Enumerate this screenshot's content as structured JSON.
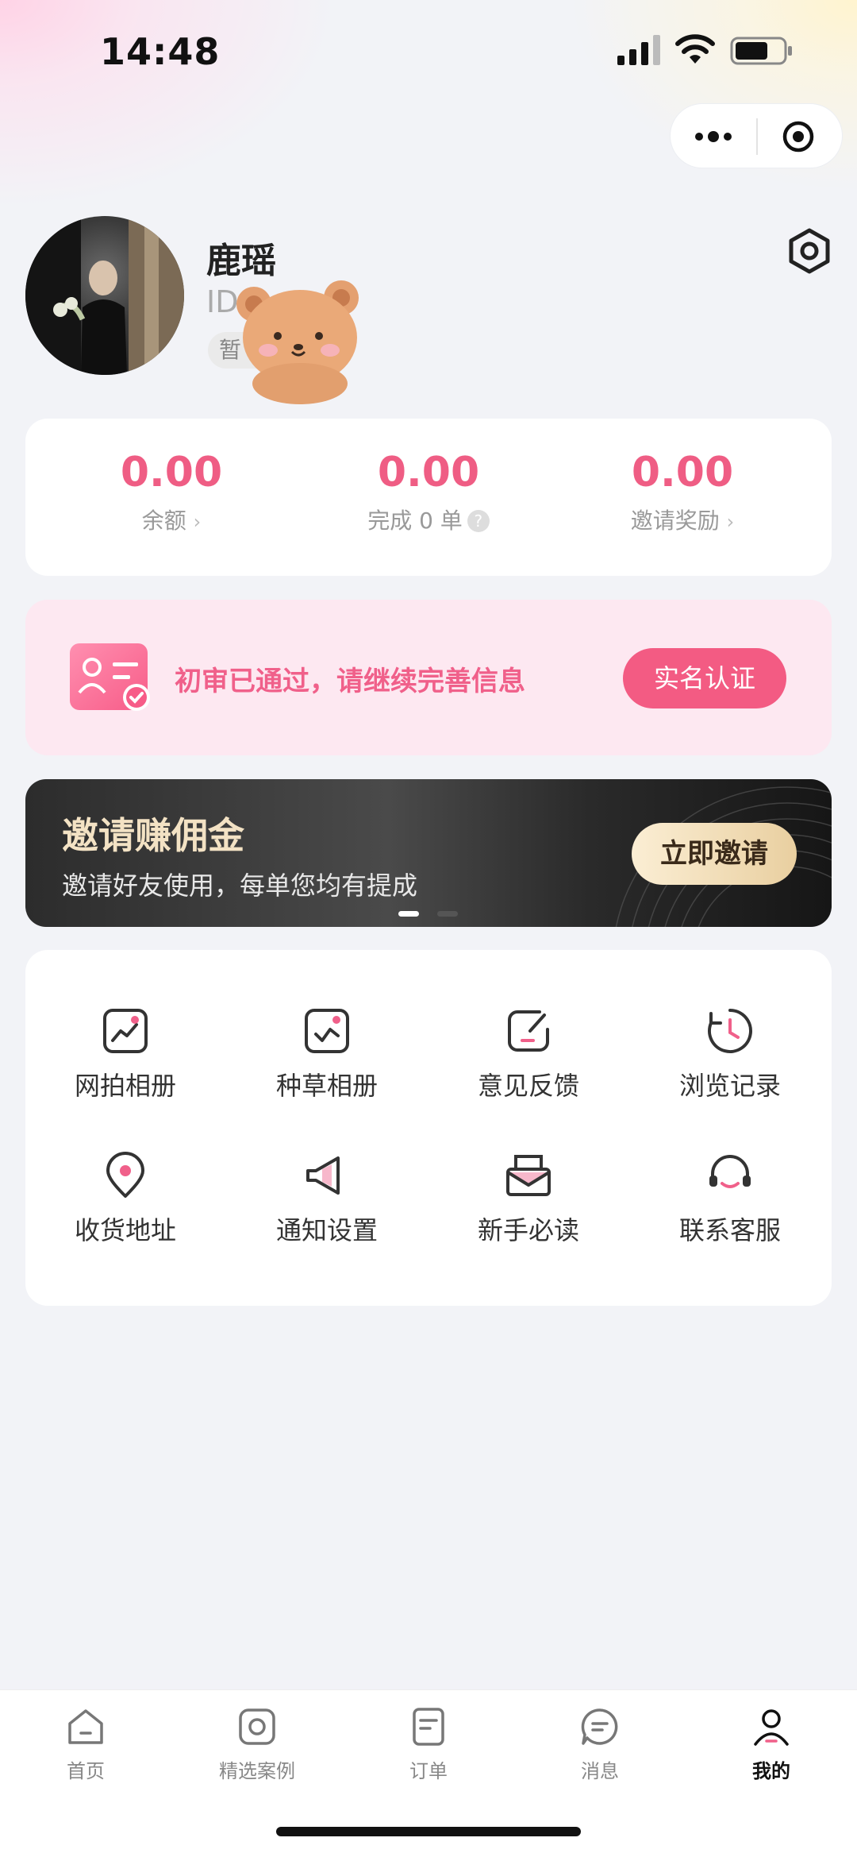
{
  "status_bar": {
    "time": "14:48"
  },
  "profile": {
    "name": "鹿瑶",
    "id_prefix": "ID",
    "tag": "暂"
  },
  "stats": [
    {
      "value": "0.00",
      "label": "余额",
      "chevron": "›"
    },
    {
      "value": "0.00",
      "label": "完成 0 单",
      "help": "?"
    },
    {
      "value": "0.00",
      "label": "邀请奖励",
      "chevron": "›"
    }
  ],
  "verify": {
    "message": "初审已通过，请继续完善信息",
    "button": "实名认证"
  },
  "invite": {
    "title": "邀请赚佣金",
    "subtitle": "邀请好友使用，每单您均有提成",
    "button": "立即邀请"
  },
  "menu": [
    {
      "label": "网拍相册",
      "icon": "photo-album-icon"
    },
    {
      "label": "种草相册",
      "icon": "recommend-album-icon"
    },
    {
      "label": "意见反馈",
      "icon": "feedback-icon"
    },
    {
      "label": "浏览记录",
      "icon": "history-clock-icon"
    },
    {
      "label": "收货地址",
      "icon": "location-pin-icon"
    },
    {
      "label": "通知设置",
      "icon": "megaphone-icon"
    },
    {
      "label": "新手必读",
      "icon": "mail-guide-icon"
    },
    {
      "label": "联系客服",
      "icon": "headset-icon"
    }
  ],
  "tabs": [
    {
      "label": "首页",
      "icon": "home-icon"
    },
    {
      "label": "精选案例",
      "icon": "camera-icon"
    },
    {
      "label": "订单",
      "icon": "order-doc-icon"
    },
    {
      "label": "消息",
      "icon": "message-bubble-icon"
    },
    {
      "label": "我的",
      "icon": "user-icon",
      "active": true
    }
  ],
  "colors": {
    "accent": "#ef5d84",
    "verify_bg": "#fde8f1",
    "invite_gold": "#f3e2c4"
  }
}
